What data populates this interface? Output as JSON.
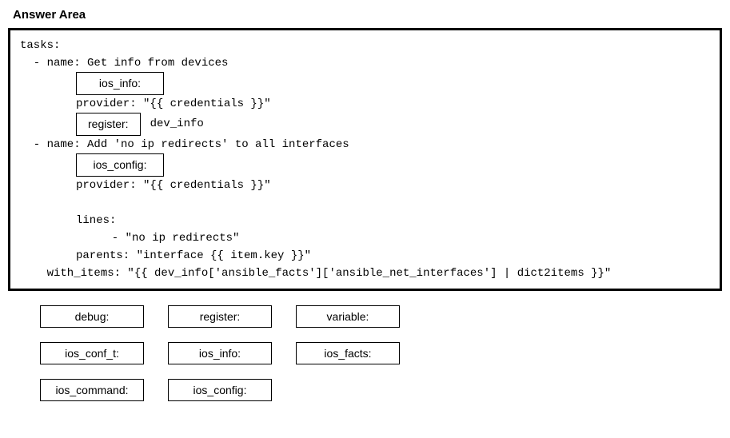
{
  "title": "Answer Area",
  "code": {
    "tasks_label": "tasks:",
    "task1_name": "  - name: Get info from devices",
    "slot1": "ios_info:",
    "provider_line": "provider: \"{{ credentials }}\"",
    "slot2": "register:",
    "dev_info": "dev_info",
    "task2_name": "  - name: Add 'no ip redirects' to all interfaces",
    "slot3": "ios_config:",
    "provider_line2": "provider: \"{{ credentials }}\"",
    "lines_label": "lines:",
    "lines_value": "  - \"no ip redirects\"",
    "parents_line": "parents: \"interface {{ item.key }}\"",
    "with_items_line": "    with_items: \"{{ dev_info['ansible_facts']['ansible_net_interfaces'] | dict2items }}\""
  },
  "options": {
    "row1": [
      "debug:",
      "register:",
      "variable:"
    ],
    "row2": [
      "ios_conf_t:",
      "ios_info:",
      "ios_facts:"
    ],
    "row3": [
      "ios_command:",
      "ios_config:"
    ]
  }
}
